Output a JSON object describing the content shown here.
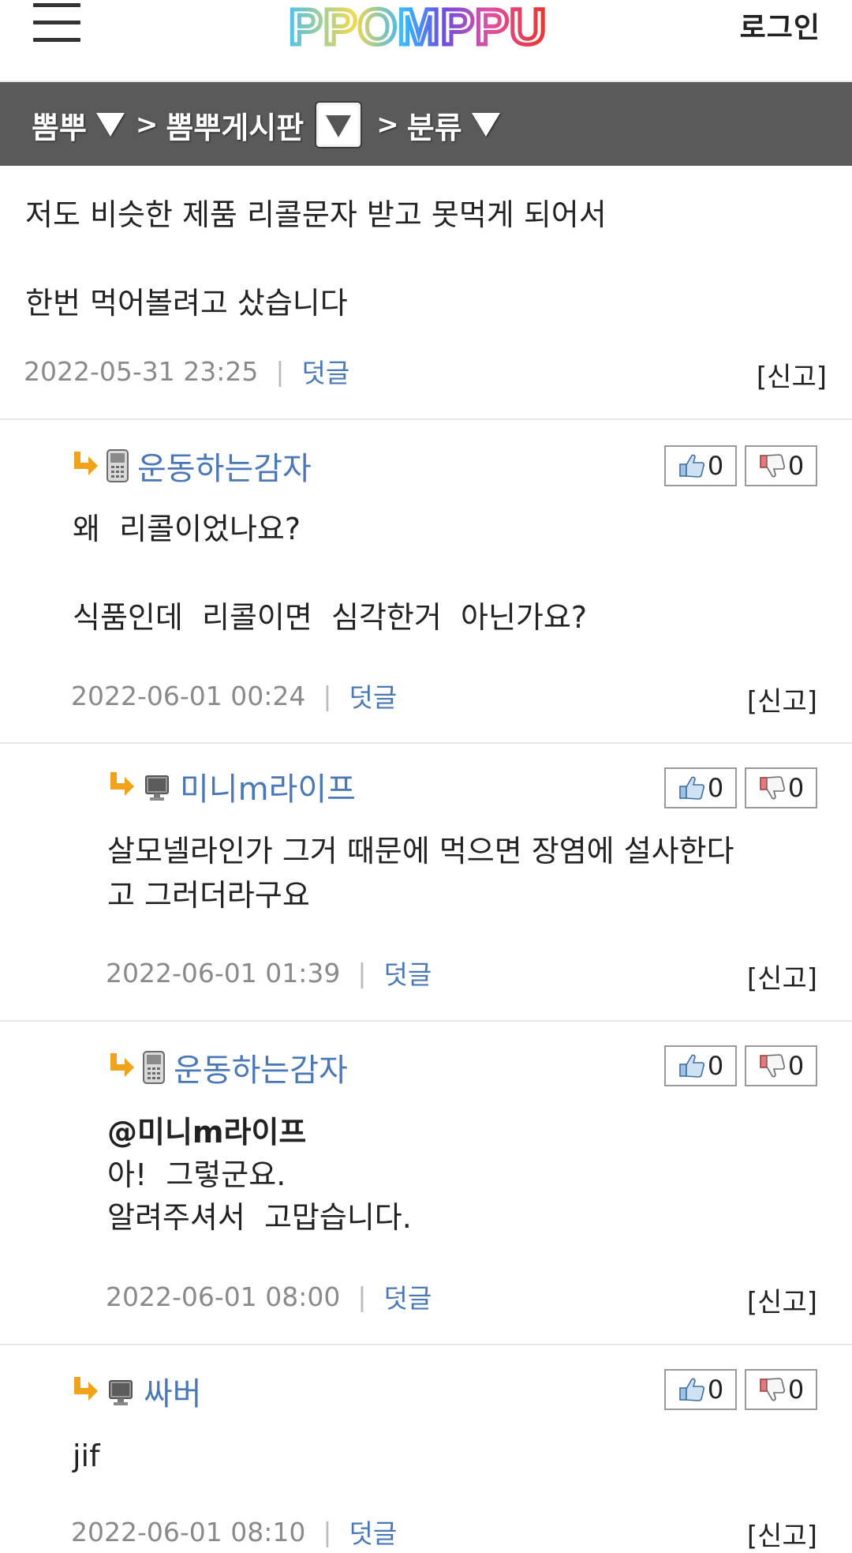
{
  "header": {
    "logo_text": "PPOMPPU",
    "login_label": "로그인"
  },
  "breadcrumb": {
    "site": "뽐뿌",
    "board": "뽐뿌게시판",
    "category": "분류",
    "separator": ">"
  },
  "post": {
    "line1": "저도 비슷한 제품 리콜문자 받고 못먹게 되어서",
    "line2": "한번 먹어볼려고 샀습니다",
    "date": "2022-05-31 23:25",
    "reply_label": "덧글",
    "report_label": "[신고]"
  },
  "comments": [
    {
      "author": "운동하는감자",
      "device": "mobile",
      "up": "0",
      "down": "0",
      "line1": "왜  리콜이었나요?",
      "line2": "식품인데  리콜이면  심각한거  아닌가요?",
      "date": "2022-06-01 00:24",
      "reply_label": "덧글",
      "report_label": "[신고]"
    },
    {
      "author": "미니m라이프",
      "device": "pc",
      "up": "0",
      "down": "0",
      "line1": "살모넬라인가 그거 때문에 먹으면 장염에 설사한다",
      "line2": "고 그러더라구요",
      "date": "2022-06-01 01:39",
      "reply_label": "덧글",
      "report_label": "[신고]"
    },
    {
      "author": "운동하는감자",
      "device": "mobile",
      "up": "0",
      "down": "0",
      "mention": "@미니m라이프",
      "line1": "아!  그렇군요.",
      "line2": "알려주셔서  고맙습니다.",
      "date": "2022-06-01 08:00",
      "reply_label": "덧글",
      "report_label": "[신고]"
    },
    {
      "author": "싸버",
      "device": "pc",
      "up": "0",
      "down": "0",
      "line1": "jif",
      "date": "2022-06-01 08:10",
      "reply_label": "덧글",
      "report_label": "[신고]"
    }
  ],
  "colors": {
    "link_blue": "#4a78b6",
    "breadcrumb_bg": "#5a5a5a",
    "arrow_orange": "#f0a21a"
  },
  "icons": {
    "menu": "hamburger-menu-icon",
    "reply_arrow": "reply-arrow-icon",
    "mobile": "mobile-phone-icon",
    "pc": "desktop-monitor-icon",
    "up": "thumbs-up-icon",
    "down": "thumbs-down-icon"
  }
}
